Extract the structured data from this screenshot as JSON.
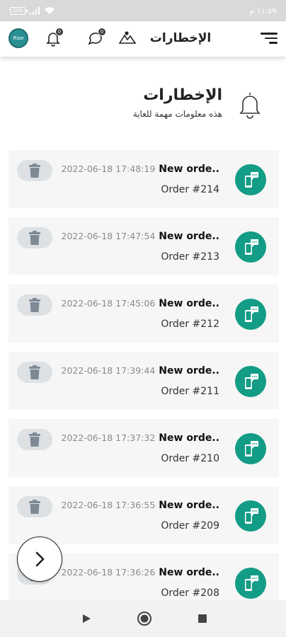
{
  "status_bar": {
    "battery_level": "100",
    "time": "١١:٥٩ م"
  },
  "app_bar": {
    "title": "الإخطارات",
    "avatar_label": "Rise",
    "notifications_badge": "0",
    "messages_badge": "0"
  },
  "page_header": {
    "title": "الإخطارات",
    "subtitle": "هذه معلومات مهمة للغاية"
  },
  "notifications": [
    {
      "title": "New orde..",
      "date": "2022-06-18 17:48:19",
      "subtitle": "Order #214"
    },
    {
      "title": "New orde..",
      "date": "2022-06-18 17:47:54",
      "subtitle": "Order #213"
    },
    {
      "title": "New orde..",
      "date": "2022-06-18 17:45:06",
      "subtitle": "Order #212"
    },
    {
      "title": "New orde..",
      "date": "2022-06-18 17:39:44",
      "subtitle": "Order #211"
    },
    {
      "title": "New orde..",
      "date": "2022-06-18 17:37:32",
      "subtitle": "Order #210"
    },
    {
      "title": "New orde..",
      "date": "2022-06-18 17:36:55",
      "subtitle": "Order #209"
    },
    {
      "title": "New orde..",
      "date": "2022-06-18 17:36:26",
      "subtitle": "Order #208"
    }
  ],
  "colors": {
    "accent": "#139c86",
    "card_bg": "#f6f6f6",
    "delete_bg": "#dde1e4",
    "delete_icon": "#7d8a96"
  },
  "icons": {
    "notification_item": "message-phone-icon",
    "delete": "trash-icon",
    "fab": "chevron-right-icon"
  }
}
